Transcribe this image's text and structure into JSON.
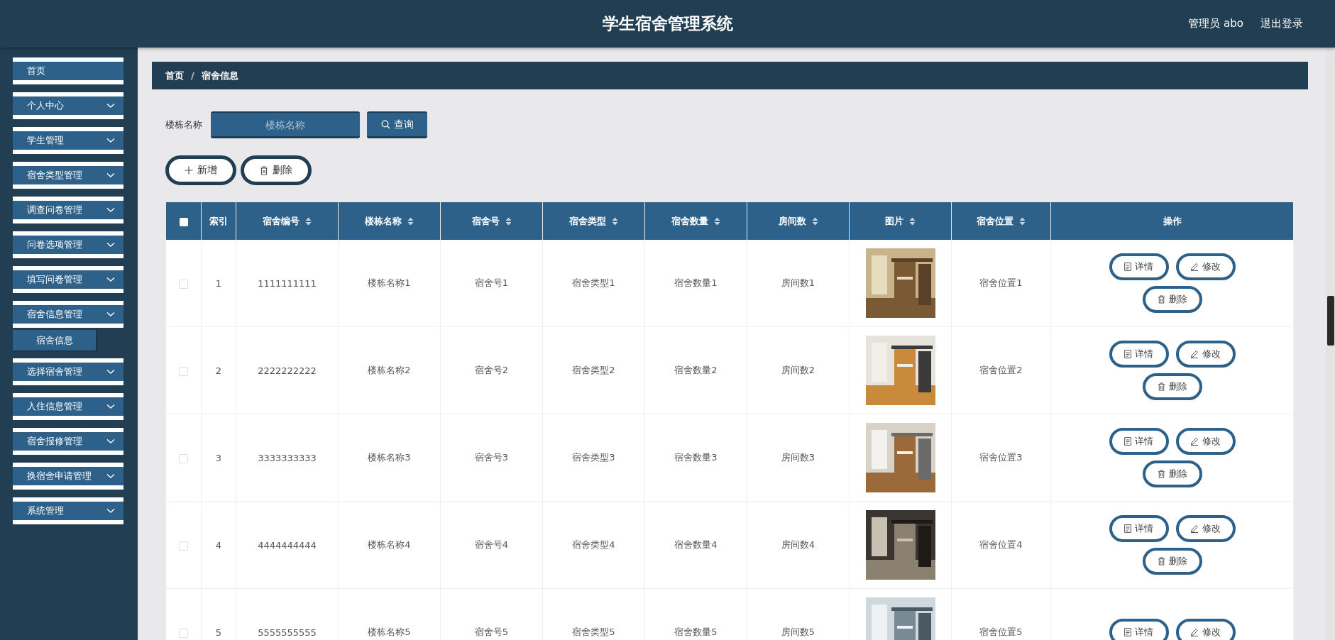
{
  "header": {
    "title": "学生宿舍管理系统",
    "user": "管理员 abo",
    "logout": "退出登录"
  },
  "sidebar": {
    "items": [
      {
        "label": "首页",
        "kind": "link"
      },
      {
        "label": "个人中心",
        "kind": "group"
      },
      {
        "label": "学生管理",
        "kind": "group"
      },
      {
        "label": "宿舍类型管理",
        "kind": "group"
      },
      {
        "label": "调查问卷管理",
        "kind": "group"
      },
      {
        "label": "问卷选项管理",
        "kind": "group"
      },
      {
        "label": "填写问卷管理",
        "kind": "group"
      },
      {
        "label": "宿舍信息管理",
        "kind": "group",
        "children": [
          {
            "label": "宿舍信息",
            "selected": true
          }
        ]
      },
      {
        "label": "选择宿舍管理",
        "kind": "group"
      },
      {
        "label": "入住信息管理",
        "kind": "group"
      },
      {
        "label": "宿舍报修管理",
        "kind": "group"
      },
      {
        "label": "换宿舍申请管理",
        "kind": "group"
      },
      {
        "label": "系统管理",
        "kind": "group"
      }
    ]
  },
  "breadcrumb": {
    "items": [
      "首页",
      "宿舍信息"
    ],
    "separator": "/"
  },
  "search": {
    "label": "楼栋名称",
    "placeholder": "楼栋名称",
    "button": "查询"
  },
  "actions": [
    {
      "kind": "add",
      "label": "新增"
    },
    {
      "kind": "delete",
      "label": "删除"
    }
  ],
  "table": {
    "select_all": {
      "checked": false
    },
    "columns": [
      {
        "label": "索引",
        "sortable": false
      },
      {
        "label": "宿舍编号",
        "sortable": true
      },
      {
        "label": "楼栋名称",
        "sortable": true
      },
      {
        "label": "宿舍号",
        "sortable": true
      },
      {
        "label": "宿舍类型",
        "sortable": true
      },
      {
        "label": "宿舍数量",
        "sortable": true
      },
      {
        "label": "房间数",
        "sortable": true
      },
      {
        "label": "图片",
        "sortable": true
      },
      {
        "label": "宿舍位置",
        "sortable": true
      },
      {
        "label": "操作",
        "sortable": false
      }
    ],
    "rows": [
      {
        "checked": false,
        "cells": [
          "1",
          "1111111111",
          "楼栋名称1",
          "宿舍号1",
          "宿舍类型1",
          "宿舍数量1",
          "房间数1"
        ],
        "location": "宿舍位置1",
        "actions": [
          {
            "kind": "detail",
            "label": "详情"
          },
          {
            "kind": "edit",
            "label": "修改"
          },
          {
            "kind": "delete",
            "label": "删除"
          }
        ]
      },
      {
        "checked": false,
        "cells": [
          "2",
          "2222222222",
          "楼栋名称2",
          "宿舍号2",
          "宿舍类型2",
          "宿舍数量2",
          "房间数2"
        ],
        "location": "宿舍位置2",
        "actions": [
          {
            "kind": "detail",
            "label": "详情"
          },
          {
            "kind": "edit",
            "label": "修改"
          },
          {
            "kind": "delete",
            "label": "删除"
          }
        ]
      },
      {
        "checked": false,
        "cells": [
          "3",
          "3333333333",
          "楼栋名称3",
          "宿舍号3",
          "宿舍类型3",
          "宿舍数量3",
          "房间数3"
        ],
        "location": "宿舍位置3",
        "actions": [
          {
            "kind": "detail",
            "label": "详情"
          },
          {
            "kind": "edit",
            "label": "修改"
          },
          {
            "kind": "delete",
            "label": "删除"
          }
        ]
      },
      {
        "checked": false,
        "cells": [
          "4",
          "4444444444",
          "楼栋名称4",
          "宿舍号4",
          "宿舍类型4",
          "宿舍数量4",
          "房间数4"
        ],
        "location": "宿舍位置4",
        "actions": [
          {
            "kind": "detail",
            "label": "详情"
          },
          {
            "kind": "edit",
            "label": "修改"
          },
          {
            "kind": "delete",
            "label": "删除"
          }
        ]
      },
      {
        "checked": false,
        "cells": [
          "5",
          "5555555555",
          "楼栋名称5",
          "宿舍号5",
          "宿舍类型5",
          "宿舍数量5",
          "房间数5"
        ],
        "location": "宿舍位置5",
        "actions": [
          {
            "kind": "detail",
            "label": "详情"
          },
          {
            "kind": "edit",
            "label": "修改"
          }
        ]
      }
    ]
  }
}
